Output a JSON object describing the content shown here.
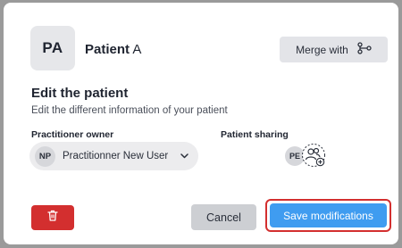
{
  "patient": {
    "initials": "PA",
    "first_name": "Patient",
    "last_name": "A"
  },
  "actions": {
    "merge_label": "Merge with"
  },
  "section": {
    "title": "Edit the patient",
    "subtitle": "Edit the different information of your patient"
  },
  "practitioner": {
    "label": "Practitioner owner",
    "initials": "NP",
    "selected": "Practitionner New User"
  },
  "sharing": {
    "label": "Patient sharing",
    "initials": "PE"
  },
  "footer": {
    "cancel_label": "Cancel",
    "save_label": "Save modifications"
  },
  "colors": {
    "primary": "#3f9cf0",
    "danger": "#d32f2f",
    "highlight_border": "#d32f2f"
  },
  "icons": {
    "merge": "merge-branch-icon",
    "delete": "trash-icon",
    "chevron": "chevron-down-icon",
    "share_add": "add-user-group-icon"
  }
}
